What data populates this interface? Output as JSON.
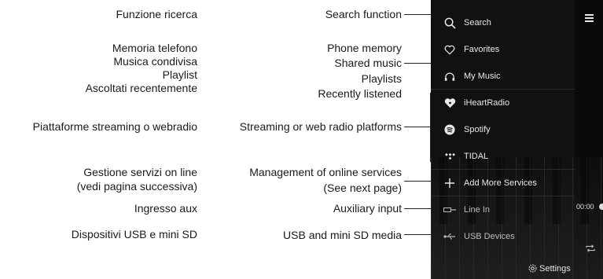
{
  "italian": {
    "search": "Funzione ricerca",
    "phone_memory": "Memoria telefono",
    "shared_music": "Musica condivisa",
    "playlist": "Playlist",
    "recently": "Ascoltati recentemente",
    "streaming": "Piattaforme streaming o  webradio",
    "management_1": "Gestione servizi on line",
    "management_2": "(vedi pagina successiva)",
    "aux": "Ingresso aux",
    "usb": "Dispositivi USB e mini SD"
  },
  "english": {
    "search": "Search function",
    "phone_memory": "Phone memory",
    "shared_music": "Shared music",
    "playlists": "Playlists",
    "recently": "Recently listened",
    "streaming": "Streaming or web radio platforms",
    "management_1": "Management of online services",
    "management_2": "(See next page)",
    "aux": "Auxiliary input",
    "usb": "USB and mini SD media"
  },
  "app": {
    "menu": [
      {
        "label": "Search",
        "icon": "search-icon"
      },
      {
        "label": "Favorites",
        "icon": "heart-icon"
      },
      {
        "label": "My Music",
        "icon": "headphones-icon"
      },
      {
        "label": "iHeartRadio",
        "icon": "iheartradio-icon"
      },
      {
        "label": "Spotify",
        "icon": "spotify-icon"
      },
      {
        "label": "TIDAL",
        "icon": "tidal-icon"
      },
      {
        "label": "Add More Services",
        "icon": "plus-icon"
      },
      {
        "label": "Line In",
        "icon": "line-in-icon"
      },
      {
        "label": "USB Devices",
        "icon": "usb-icon"
      }
    ],
    "settings_label": "Settings",
    "time": "00:00"
  }
}
